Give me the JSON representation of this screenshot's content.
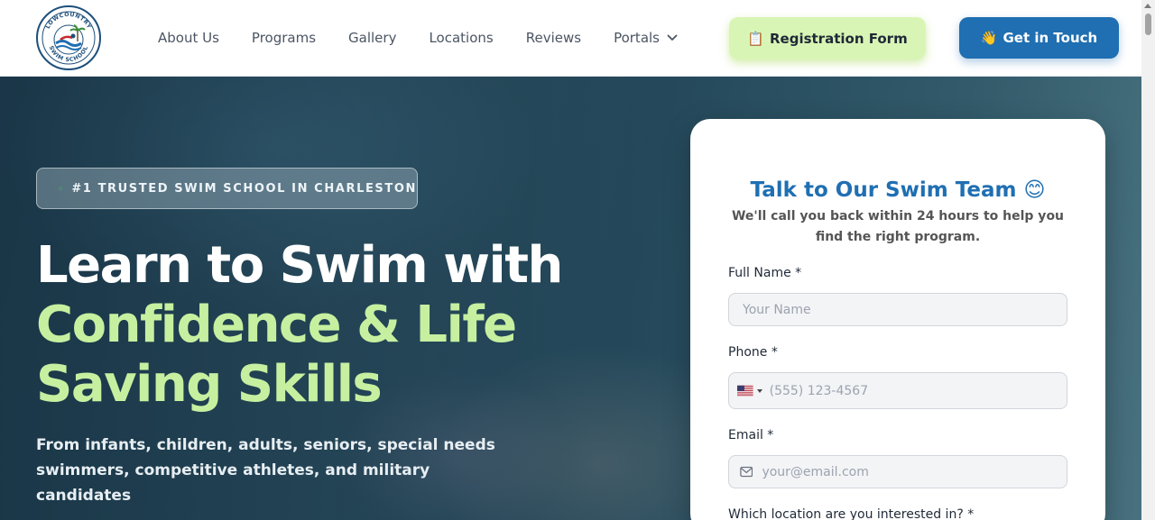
{
  "header": {
    "logo_text": "LOWCOUNTRY SWIM SCHOOL",
    "nav": [
      {
        "label": "About Us"
      },
      {
        "label": "Programs"
      },
      {
        "label": "Gallery"
      },
      {
        "label": "Locations"
      },
      {
        "label": "Reviews"
      },
      {
        "label": "Portals",
        "has_dropdown": true
      }
    ],
    "registration_button": {
      "emoji": "📋",
      "label": "Registration Form"
    },
    "contact_button": {
      "emoji": "👋",
      "label": "Get in Touch"
    }
  },
  "hero": {
    "badge": "#1 TRUSTED SWIM SCHOOL IN CHARLESTON",
    "headline_line1": "Learn to Swim with",
    "headline_line2": "Confidence & Life",
    "headline_line3": "Saving Skills",
    "subtext": "From infants, children, adults, seniors, special needs swimmers, competitive athletes, and military candidates"
  },
  "form": {
    "title": "Talk to Our Swim Team 😊",
    "subtitle": "We'll call you back within 24 hours to help you find the right program.",
    "full_name_label": "Full Name *",
    "full_name_placeholder": "Your Name",
    "phone_label": "Phone *",
    "phone_placeholder": "(555) 123-4567",
    "email_label": "Email *",
    "email_placeholder": "your@email.com",
    "location_label": "Which location are you interested in? *"
  },
  "colors": {
    "brand_blue": "#1f6fb2",
    "accent_green": "#c6f0a0",
    "registration_bg": "#d9f5b5"
  }
}
